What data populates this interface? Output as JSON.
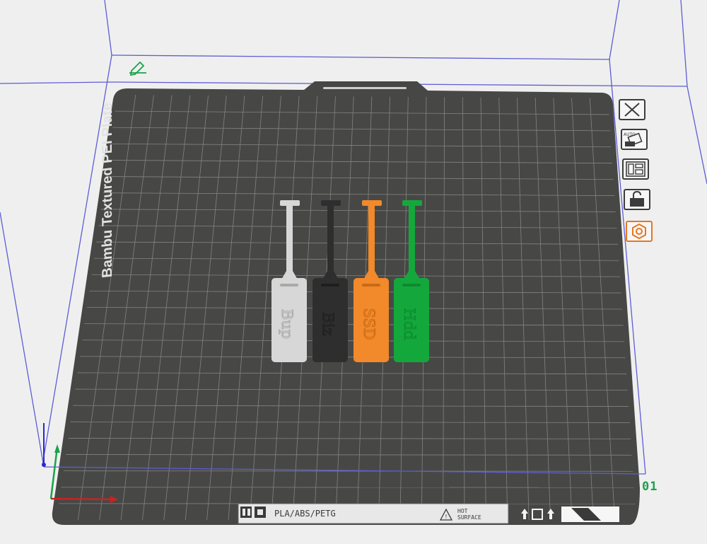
{
  "colors": {
    "background": "#efefef",
    "bed_surface": "#474846",
    "grid_line": "#8a8a86",
    "bounding_box": "#5d5dd6",
    "accent_green": "#1aa24a",
    "accent_orange": "#e6771f",
    "axis_x": "#cc2222",
    "axis_y": "#1aa24a",
    "axis_z": "#2a2ad0"
  },
  "plate": {
    "name": "Bambu Textured PEI Plate",
    "number": "01",
    "label_strip": {
      "materials": "PLA/ABS/PETG",
      "warning_line1": "HOT",
      "warning_line2": "SURFACE"
    }
  },
  "toolbar": {
    "buttons": [
      {
        "name": "close-plate-button",
        "icon": "x-icon"
      },
      {
        "name": "auto-orient-button",
        "icon": "auto-orient-icon"
      },
      {
        "name": "arrange-button",
        "icon": "arrange-icon"
      },
      {
        "name": "lock-button",
        "icon": "unlock-icon"
      },
      {
        "name": "plate-settings-button",
        "icon": "hexagon-gear-icon",
        "active": true
      }
    ]
  },
  "models": [
    {
      "label": "Bup",
      "color": "#d7d7d7",
      "text_color": "#a9a9a9"
    },
    {
      "label": "Biz",
      "color": "#2e2e2e",
      "text_color": "#1e1e1e"
    },
    {
      "label": "SSD",
      "color": "#f2892a",
      "text_color": "#c96a16"
    },
    {
      "label": "Hdd",
      "color": "#14a83c",
      "text_color": "#0c8a2e"
    }
  ],
  "edit_icon": "pencil-edit-icon"
}
